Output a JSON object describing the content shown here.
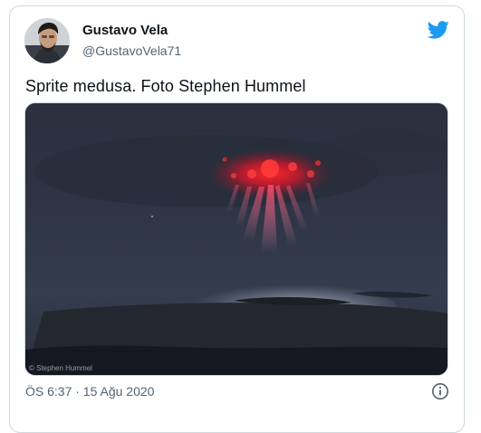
{
  "tweet": {
    "author_name": "Gustavo Vela",
    "author_handle": "@GustavoVela71",
    "text": "Sprite medusa. Foto Stephen Hummel",
    "timestamp": "ÖS 6:37 · 15 Ağu 2020"
  },
  "media": {
    "watermark": "© Stephen Hummel"
  },
  "icons": {
    "brand": "twitter-bird-icon",
    "info": "info-icon"
  },
  "colors": {
    "twitter_blue": "#1d9bf0",
    "secondary_text": "#536471",
    "border": "#cfd9de"
  }
}
